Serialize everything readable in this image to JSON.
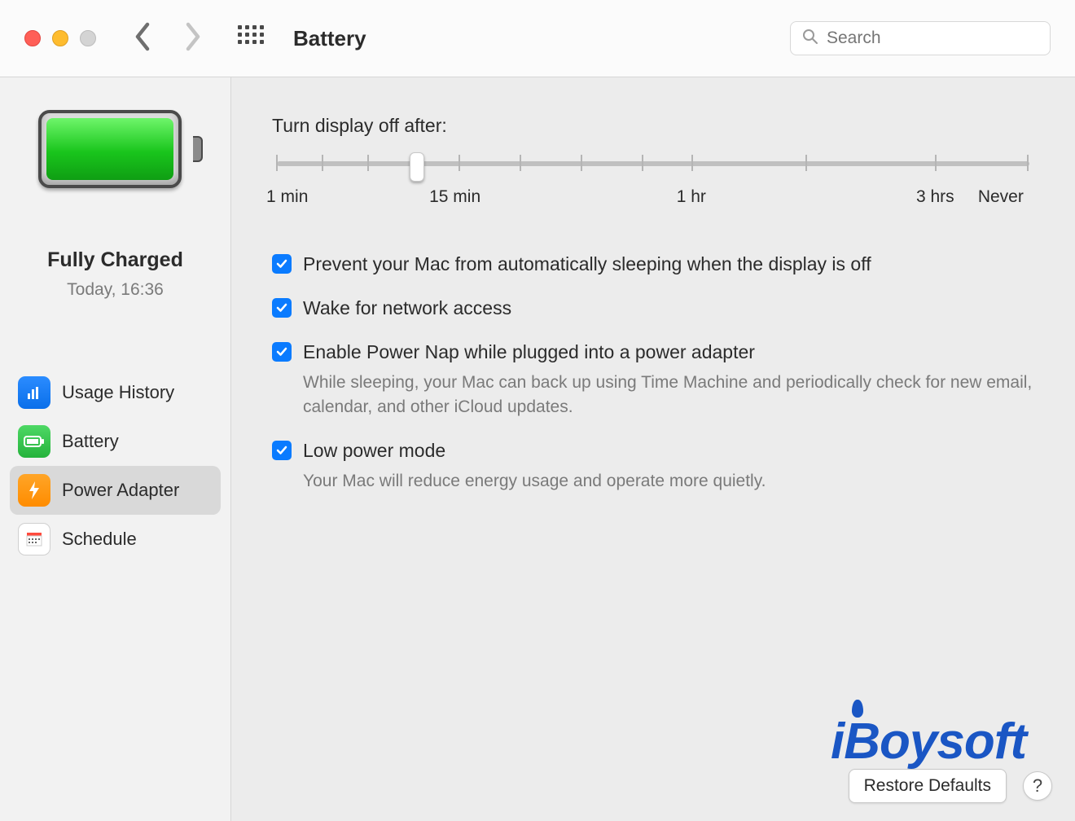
{
  "header": {
    "title": "Battery",
    "search_placeholder": "Search"
  },
  "sidebar": {
    "status_title": "Fully Charged",
    "status_time": "Today, 16:36",
    "items": [
      {
        "label": "Usage History"
      },
      {
        "label": "Battery"
      },
      {
        "label": "Power Adapter"
      },
      {
        "label": "Schedule"
      }
    ]
  },
  "main": {
    "slider_label": "Turn display off after:",
    "slider_labels": {
      "min": "1 min",
      "fifteen": "15 min",
      "hour": "1 hr",
      "three": "3 hrs",
      "never": "Never"
    },
    "options": [
      {
        "label": "Prevent your Mac from automatically sleeping when the display is off",
        "desc": ""
      },
      {
        "label": "Wake for network access",
        "desc": ""
      },
      {
        "label": "Enable Power Nap while plugged into a power adapter",
        "desc": "While sleeping, your Mac can back up using Time Machine and periodically check for new email, calendar, and other iCloud updates."
      },
      {
        "label": "Low power mode",
        "desc": "Your Mac will reduce energy usage and operate more quietly."
      }
    ],
    "restore_label": "Restore Defaults",
    "help_label": "?"
  },
  "watermark": "iBoysoft"
}
